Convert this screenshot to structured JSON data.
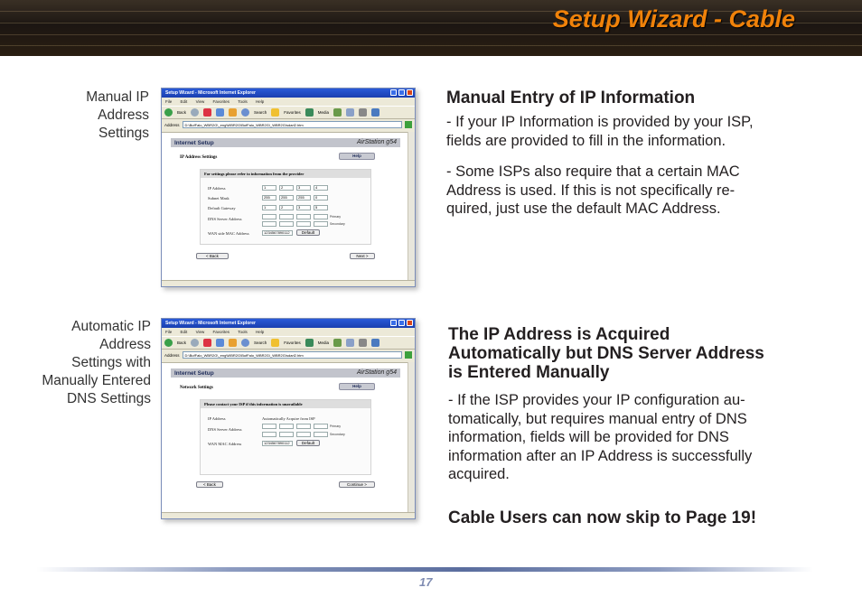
{
  "header": {
    "title": "Setup Wizard - Cable"
  },
  "captions": {
    "manual": [
      "Manual IP",
      "Address",
      "Settings"
    ],
    "auto": [
      "Automatic IP",
      "Address",
      "Settings with",
      "Manually Entered",
      "DNS Settings"
    ]
  },
  "shot1": {
    "window_title": "Setup Wizard - Microsoft Internet Explorer",
    "menu": [
      "File",
      "Edit",
      "View",
      "Favorites",
      "Tools",
      "Help"
    ],
    "toolbar": {
      "back": "Back",
      "search": "Search",
      "favorites": "Favorites",
      "media": "Media"
    },
    "address_label": "Address",
    "address_value": "D:\\BufFalo_WBR2G\\_eng\\WBR2G\\BufFalo_WBR2G\\_WBR2G\\sdarl2.htm",
    "page_title": "Internet Setup",
    "logo": "AirStation g54",
    "section": "IP Address Settings",
    "help_label": "Help",
    "panel_title": "For settings please refer to information from the provider",
    "fields": {
      "ip": {
        "label": "IP Address",
        "values": [
          "1",
          "2",
          "3",
          "4"
        ]
      },
      "subnet": {
        "label": "Subnet Mask",
        "values": [
          "255",
          "255",
          "255",
          "0"
        ]
      },
      "gateway": {
        "label": "Default Gateway",
        "values": [
          "1",
          "2",
          "3",
          "5"
        ]
      },
      "dns": {
        "label": "DNS Server Address",
        "primary": "Primary",
        "secondary": "Secondary"
      },
      "mac": {
        "label": "WAN side MAC Address",
        "value": "1234567890112",
        "default_button": "Default"
      }
    },
    "back_button": "< Back",
    "next_button": "Next >"
  },
  "shot2": {
    "window_title": "Setup Wizard - Microsoft Internet Explorer",
    "menu": [
      "File",
      "Edit",
      "View",
      "Favorites",
      "Tools",
      "Help"
    ],
    "toolbar": {
      "back": "Back",
      "search": "Search",
      "favorites": "Favorites",
      "media": "Media"
    },
    "address_label": "Address",
    "address_value": "D:\\BufFalo_WBR2G\\_eng\\WBR2G\\BufFalo_WBR2G\\_WBR2G\\sdarl2.htm",
    "page_title": "Internet Setup",
    "logo": "AirStation g54",
    "section": "Network Settings",
    "help_label": "Help",
    "panel_title": "Please contact your ISP if this information is unavailable",
    "fields": {
      "ip": {
        "label": "IP Address",
        "value": "Automatically Acquire from ISP"
      },
      "dns": {
        "label": "DNS Server Address",
        "primary": "Primary",
        "secondary": "Secondary"
      },
      "mac": {
        "label": "WAN MAC Address",
        "value": "1234567890112",
        "default_button": "Default"
      }
    },
    "back_button": "< Back",
    "next_button": "Continue >"
  },
  "section1": {
    "heading": "Manual Entry of IP Information",
    "para1": [
      "- If your IP Information is provided by your ISP,",
      "fields are provided to fill in the information."
    ],
    "para2": [
      "- Some ISPs also require that a certain MAC",
      "Address is used. If this is not specifically re-",
      "quired, just use the default MAC Address."
    ]
  },
  "section2": {
    "heading": [
      "The IP Address is Acquired",
      "Automatically but DNS Server Address",
      "is Entered Manually"
    ],
    "para": [
      "- If the ISP provides your IP configuration au-",
      "tomatically, but requires manual entry of DNS",
      "information, fields will be provided for DNS",
      "information after an IP Address is successfully",
      "acquired."
    ],
    "note": "Cable Users can now skip to Page 19!"
  },
  "footer": {
    "page_number": "17"
  },
  "colors": {
    "accent": "#f0820a",
    "header_bg": "#1c1612",
    "footer_rule": "#5a6d9e",
    "text": "#231f20"
  }
}
